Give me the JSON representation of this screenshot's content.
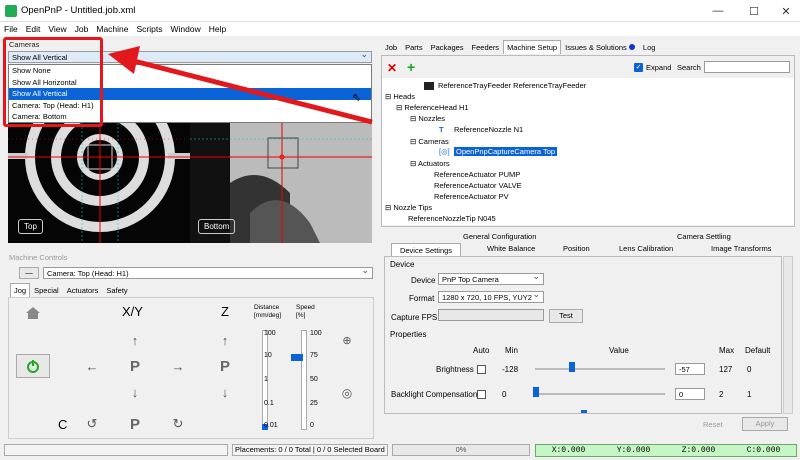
{
  "window": {
    "title": "OpenPnP - Untitled.job.xml",
    "min": "—",
    "max": "☐",
    "close": "✕"
  },
  "menu": [
    "File",
    "Edit",
    "View",
    "Job",
    "Machine",
    "Scripts",
    "Window",
    "Help"
  ],
  "cameras": {
    "label": "Cameras",
    "selected": "Show All Vertical",
    "options": [
      "Show None",
      "Show All Horizontal",
      "Show All Vertical",
      "Camera: Top (Head: H1)",
      "Camera: Bottom"
    ],
    "selected_index": 2,
    "views": [
      "Top",
      "Bottom"
    ]
  },
  "machine_controls": {
    "label": "Machine Controls",
    "camera_select": "Camera: Top (Head: H1)",
    "tabs": [
      "Jog",
      "Special",
      "Actuators",
      "Safety"
    ],
    "xy": "X/Y",
    "z": "Z",
    "c": "C",
    "p": "P",
    "distance_label": "Distance\n[mm/deg]",
    "speed_label": "Speed\n[%]",
    "distance_ticks": [
      "100",
      "10",
      "1",
      "0.1",
      "0.01"
    ],
    "speed_ticks": [
      "100",
      "75",
      "50",
      "25",
      "0"
    ],
    "speed_value_pct": 75
  },
  "right_tabs": [
    "Job",
    "Parts",
    "Packages",
    "Feeders",
    "Machine Setup",
    "Issues & Solutions",
    "Log"
  ],
  "right_tab_active": 4,
  "toolbar": {
    "expand": "Expand",
    "search": "Search"
  },
  "tree": {
    "items": [
      "ReferenceTrayFeeder ReferenceTrayFeeder",
      "Heads",
      "ReferenceHead H1",
      "Nozzles",
      "ReferenceNozzle N1",
      "Cameras",
      "OpenPnpCaptureCamera Top",
      "Actuators",
      "ReferenceActuator PUMP",
      "ReferenceActuator VALVE",
      "ReferenceActuator PV",
      "Nozzle Tips",
      "ReferenceNozzleTip N045"
    ]
  },
  "config_tabs_row1": [
    "General Configuration",
    "Camera Settling"
  ],
  "config_tabs_row2": [
    "Device Settings",
    "White Balance",
    "Position",
    "Lens Calibration",
    "Image Transforms"
  ],
  "device": {
    "section": "Device",
    "device_label": "Device",
    "device_value": "PnP Top Camera",
    "format_label": "Format",
    "format_value": "1280 x 720, 10 FPS, YUY2",
    "fps_label": "Capture FPS",
    "test": "Test"
  },
  "properties": {
    "section": "Properties",
    "headers": {
      "auto": "Auto",
      "min": "Min",
      "value": "Value",
      "max": "Max",
      "default": "Default"
    },
    "rows": [
      {
        "name": "Brightness",
        "min": "-128",
        "value": "-57",
        "max": "127",
        "default": "0"
      },
      {
        "name": "Backlight Compensation",
        "min": "0",
        "value": "0",
        "max": "2",
        "default": "1"
      }
    ]
  },
  "actions": {
    "reset": "Reset",
    "apply": "Apply"
  },
  "status": {
    "placements": "Placements: 0 / 0 Total | 0 / 0 Selected Board",
    "progress": "0%",
    "x": "X:0.000",
    "y": "Y:0.000",
    "z": "Z:0.000",
    "c": "C:0.000"
  },
  "colors": {
    "accent": "#0a64d8",
    "arrow": "#e3181c",
    "dro": "#c6f6c6"
  }
}
